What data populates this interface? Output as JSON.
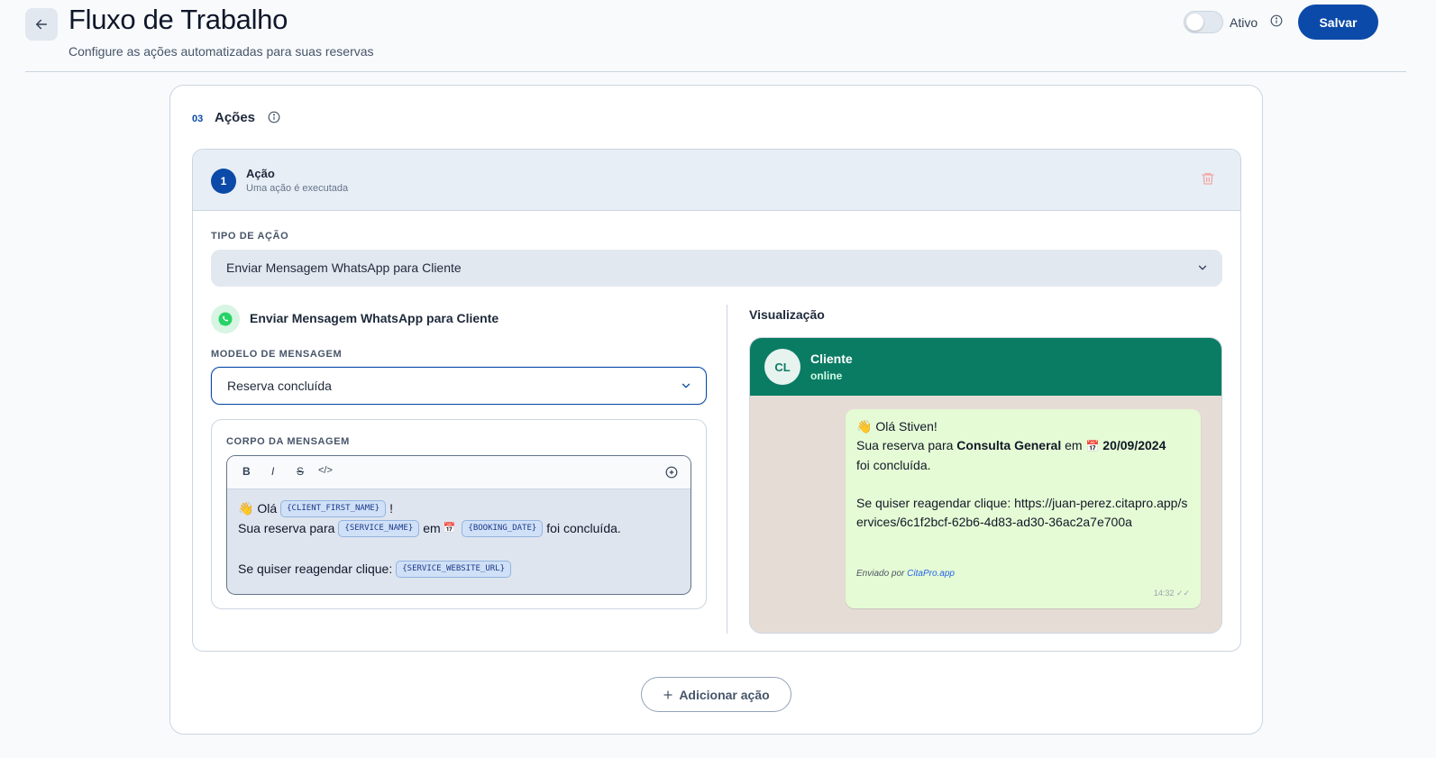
{
  "header": {
    "title": "Fluxo de Trabalho",
    "subtitle": "Configure as ações automatizadas para suas reservas",
    "toggle_label": "Ativo",
    "save_label": "Salvar"
  },
  "section": {
    "number": "03",
    "title": "Ações"
  },
  "action": {
    "step": "1",
    "title": "Ação",
    "subtitle": "Uma ação é executada",
    "type_label": "TIPO DE AÇÃO",
    "type_value": "Enviar Mensagem WhatsApp para Cliente",
    "channel_title": "Enviar Mensagem WhatsApp para Cliente",
    "template_label": "MODELO DE MENSAGEM",
    "template_value": "Reserva concluída",
    "body_label": "CORPO DA MENSAGEM"
  },
  "editor": {
    "toolbar": {
      "bold": "B",
      "italic": "I",
      "strike": "S",
      "code": "</>"
    },
    "line1_text": "👋 Olá",
    "line1_chip": "{CLIENT_FIRST_NAME}",
    "line1_end": "!",
    "line2_text": "Sua reserva para",
    "line2_chip1": "{SERVICE_NAME}",
    "line2_mid": "em",
    "line2_cal": "📅",
    "line2_chip2": "{BOOKING_DATE}",
    "line2_end": "foi concluída.",
    "line3_text": "Se quiser reagendar clique:",
    "line3_chip": "{SERVICE_WEBSITE_URL}"
  },
  "preview": {
    "label": "Visualização",
    "avatar_initials": "CL",
    "contact_name": "Cliente",
    "contact_status": "online",
    "msg_greeting": "👋 Olá Stiven!",
    "msg_reserva": "Sua reserva para",
    "msg_service": "Consulta General",
    "msg_em": "em",
    "msg_cal": "📅",
    "msg_date": "20/09/2024",
    "msg_concluded": "foi concluída.",
    "msg_reagendar": "Se quiser reagendar clique: https://juan-perez.citapro.app/services/6c1f2bcf-62b6-4d83-ad30-36ac2a7e700a",
    "footer_prefix": "Enviado por",
    "footer_link": "CitaPro.app",
    "time": "14:32 ✓✓"
  },
  "add_action_label": "Adicionar ação",
  "colors": {
    "primary": "#0b4aa8",
    "whatsapp_header": "#0b7c64",
    "bubble": "#e5fbd5"
  }
}
